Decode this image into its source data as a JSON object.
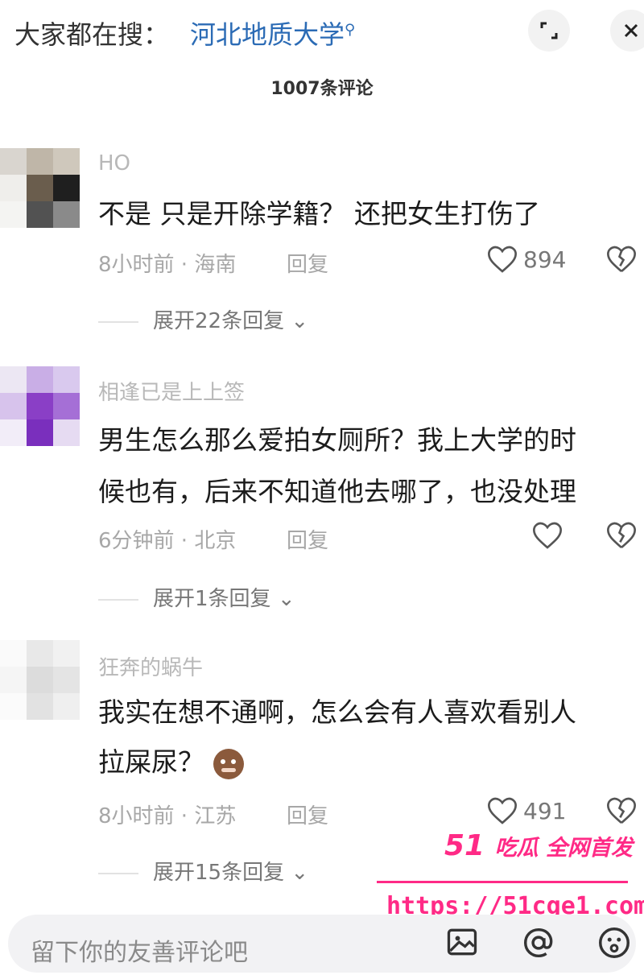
{
  "header": {
    "search_prefix": "大家都在搜：",
    "search_term": "河北地质大学",
    "comment_count": "1007条评论"
  },
  "comments": [
    {
      "username": "HO",
      "text_lines": [
        "不是 只是开除学籍？ 还把女生打伤了"
      ],
      "meta": "8小时前 · 海南",
      "reply_label": "回复",
      "likes": "894",
      "expand_label": "展开22条回复"
    },
    {
      "username": "相逢已是上上签",
      "text_lines": [
        "男生怎么那么爱拍女厕所？我上大学的时",
        "候也有，后来不知道他去哪了，也没处理"
      ],
      "meta": "6分钟前 · 北京",
      "reply_label": "回复",
      "likes": "",
      "expand_label": "展开1条回复"
    },
    {
      "username": "狂奔的蜗牛",
      "text_lines": [
        "我实在想不通啊，怎么会有人喜欢看别人",
        "拉屎尿？"
      ],
      "meta": "8小时前 · 江苏",
      "reply_label": "回复",
      "likes": "491",
      "expand_label": "展开15条回复"
    }
  ],
  "input": {
    "placeholder": "留下你的友善评论吧"
  },
  "watermark": {
    "logo_num": "51",
    "logo_text": "吃瓜 全网首发",
    "url": "https://51cge1.com"
  },
  "icons": {
    "expand": "expand-icon",
    "close": "close-icon",
    "like": "heart-icon",
    "dislike": "broken-heart-icon",
    "image": "image-icon",
    "mention": "at-icon",
    "emoji": "emoji-icon"
  },
  "colors": {
    "search_term": "#2b6bb5",
    "watermark": "#ff2a86",
    "avatar_2": "#8a3fc6"
  }
}
